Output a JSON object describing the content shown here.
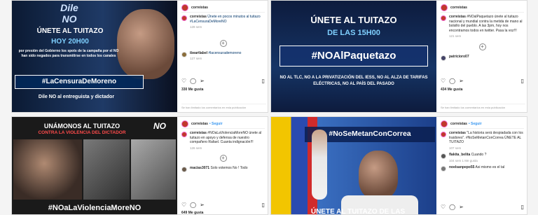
{
  "posts": [
    {
      "image": {
        "brand": "Dile NO",
        "headline": "ÚNETE AL TUITAZO",
        "time": "HOY 20H00",
        "body": "por presión del Gobierno los spots de la campaña por el NO han sido negados para transmitirse en todos los canales",
        "hashtag": "#LaCensuraDeMoreno",
        "footer": "Dile NO al entreguista y dictador"
      },
      "username": "correistas",
      "caption": "Únete en pocos minutos al tuitazo #LaCensuraDeMoreNO",
      "caption_time": "128 sem",
      "comment_user": "ibeartlabel",
      "comment_text": "#lacensurademoreno",
      "comment_time": "127 sem",
      "likes": "330 Me gusta",
      "comments_off": "Se han limitado los comentarios en esta publicación"
    },
    {
      "image": {
        "headline": "ÚNETE AL TUITAZO",
        "time": "DE LAS 15H00",
        "hashtag": "#NOAlPaquetazo",
        "body": "NO AL TLC, NO A LA PRIVATIZACIÓN DEL IESS, NO AL ALZA DE TARIFAS ELÉCTRICAS, NO AL PAÍS DEL PASADO"
      },
      "username": "correistas",
      "caption": "#NOalPaquetazo únete al tuitazo nacional y mundial contra la metida de mano al bolsillo del pueblo. A las 3pm, hoy nos encontramos todos en twitter. Pasa la voz!!!",
      "caption_time": "121 sem",
      "comment_user": "patricioro07",
      "likes": "434 Me gusta",
      "comments_off": "Se han limitado los comentarios en esta publicación"
    },
    {
      "image": {
        "headline": "UNÁMONOS AL TUITAZO",
        "sub": "CONTRA LA VIOLENCIA DEL DICTADOR",
        "brand": "NO",
        "hashtag": "#NOaLaViolenciaMoreNO"
      },
      "username": "correistas",
      "follow": "• Seguir",
      "caption": "#NOaLaViolenciaMoreNO únete al tuitazo en apoyo y defensa de nuestro compañero Rafael. Cuanta indignación!!!",
      "caption_time": "126 sem",
      "comment_user": "macias3071",
      "comment_text": "Solo votemos No ! Todo",
      "likes": "649 Me gusta"
    },
    {
      "image": {
        "hashtag": "#NoSeMetanConCorrea",
        "headline": "ÚNETE AL TUITAZO DE LAS"
      },
      "username": "correistas",
      "follow": "• Seguir",
      "caption": "\"La historia será despiadada con los traidores\". #NoSeMetanConCorrea ÚNETE AL TUITAZO",
      "caption_time": "107 sem",
      "comment1_user": "flakita_belita",
      "comment1_text": "Cuando ?",
      "comment1_time": "104 sem",
      "comment1_meta": "1 Me gusta",
      "comment2_user": "noelsanpepo55",
      "comment2_text": "Asi mismo es el tal"
    }
  ]
}
